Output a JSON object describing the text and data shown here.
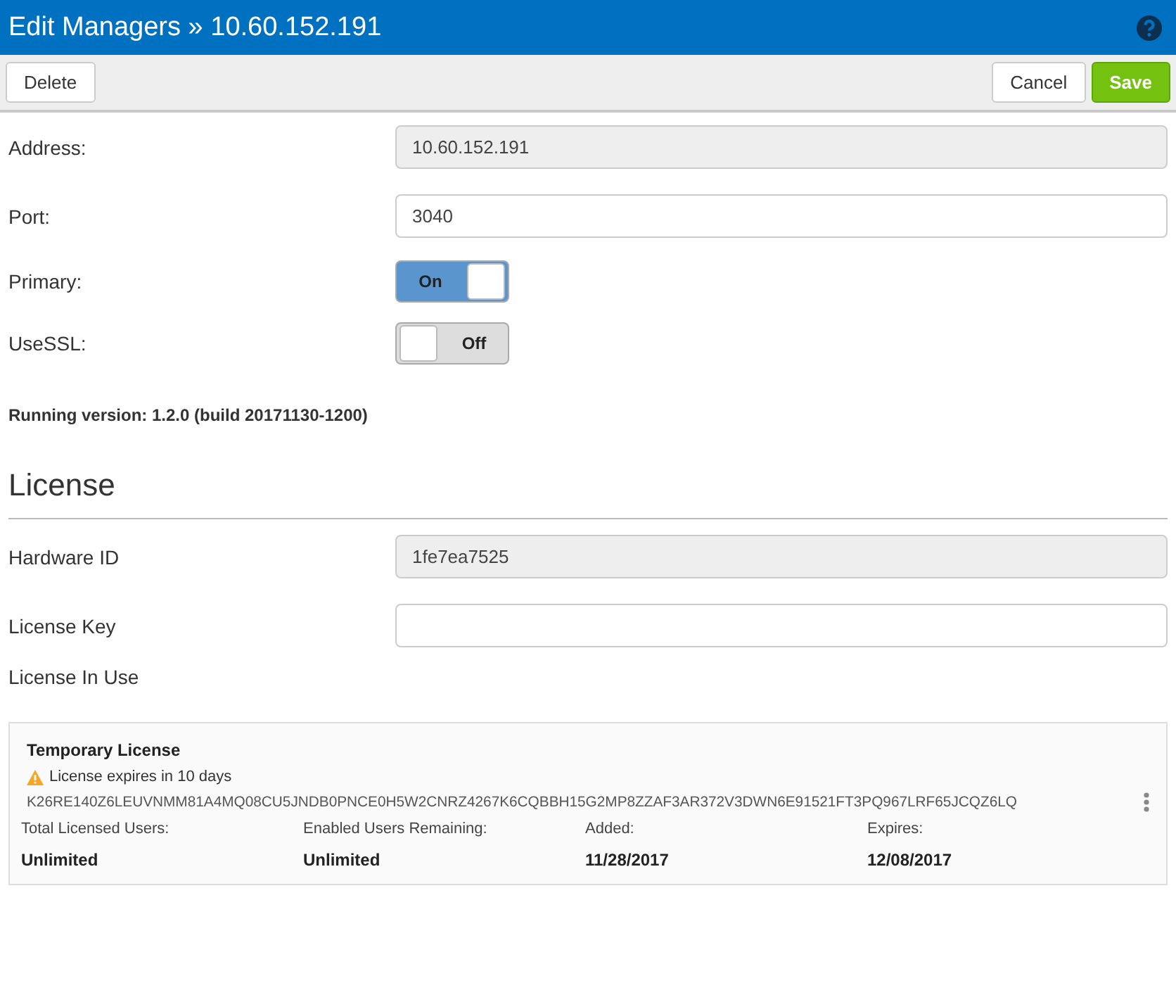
{
  "window": {
    "title": "Edit Managers » 10.60.152.191"
  },
  "toolbar": {
    "left_buttons": [
      "Delete"
    ],
    "right_buttons": [
      {
        "label": "Cancel",
        "kind": "default"
      },
      {
        "label": "Save",
        "kind": "primary"
      }
    ]
  },
  "fields": [
    {
      "kind": "text",
      "label": "Address:",
      "value": "10.60.152.191",
      "disabled": true
    },
    {
      "kind": "text",
      "label": "Port:",
      "value": "3040",
      "disabled": false
    },
    {
      "kind": "toggle",
      "label": "Primary:",
      "on": true,
      "state_label": "On"
    },
    {
      "kind": "toggle",
      "label": "UseSSL:",
      "on": false,
      "state_label": "Off"
    }
  ],
  "running_version": "Running version: 1.2.0 (build 20171130-1200)",
  "license": {
    "heading": "License",
    "fields": [
      {
        "kind": "text",
        "label": "Hardware ID",
        "value": "1fe7ea7525",
        "disabled": true
      },
      {
        "kind": "text",
        "label": "License Key",
        "disabled": false
      },
      {
        "kind": "label",
        "label": "License In Use"
      }
    ],
    "card": {
      "title": "Temporary License",
      "warning": "License expires in 10 days",
      "key": "K26RE140Z6LEUVNMM81A4MQ08CU5JNDB0PNCE0H5W2CNRZ4267K6CQBBH15G2MP8ZZAF3AR372V3DWN6E91521FT3PQ967LRF65JCQZ6LQ",
      "stats": [
        {
          "label": "Total Licensed Users:",
          "value": "Unlimited"
        },
        {
          "label": "Enabled Users Remaining:",
          "value": "Unlimited"
        },
        {
          "label": "Added:",
          "value": "11/28/2017"
        },
        {
          "label": "Expires:",
          "value": "12/08/2017"
        }
      ]
    }
  }
}
